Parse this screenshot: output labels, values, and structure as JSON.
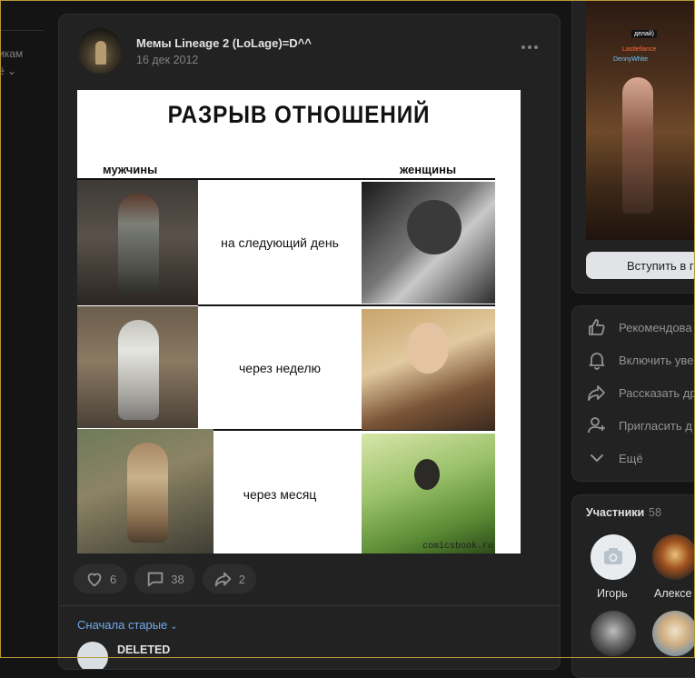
{
  "left_nav": {
    "line1": "икам",
    "line2": "ё ⌄"
  },
  "post": {
    "group_name": "Мемы Lineage 2 (LoLage)=D^^",
    "date": "16 дек 2012",
    "meme": {
      "title": "РАЗРЫВ ОТНОШЕНИЙ",
      "col_men": "мужчины",
      "col_women": "женщины",
      "rows": [
        "на следующий день",
        "через неделю",
        "через месяц"
      ],
      "watermark": "comicsbook.ru"
    },
    "likes": "6",
    "comments": "38",
    "shares": "2",
    "sort_label": "Сначала старые",
    "first_comment_author": "DELETED"
  },
  "sidebar": {
    "cover": {
      "tag": "делай)",
      "name1": "Lastlefiance",
      "name2": "DennyWhite"
    },
    "join_label": "Вступить в г",
    "menu": [
      {
        "label": "Рекомендова",
        "icon": "thumbs-up-icon"
      },
      {
        "label": "Включить уве",
        "icon": "bell-icon"
      },
      {
        "label": "Рассказать др",
        "icon": "share-icon"
      },
      {
        "label": "Пригласить д",
        "icon": "add-user-icon"
      },
      {
        "label": "Ещё",
        "icon": "chevron-down-icon"
      }
    ],
    "members": {
      "title": "Участники",
      "count": "58",
      "people": [
        {
          "name": "Игорь"
        },
        {
          "name": "Алексе"
        }
      ]
    }
  },
  "colors": {
    "accent": "#71aaeb",
    "card": "#222222",
    "background": "#141414"
  }
}
